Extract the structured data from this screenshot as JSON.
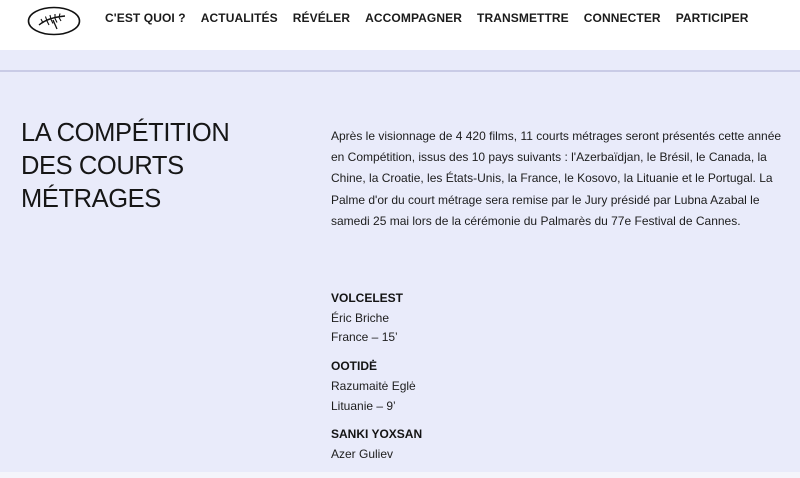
{
  "header": {
    "logo_icon": "palme-logo-icon",
    "nav": [
      {
        "label": "C'EST QUOI ?"
      },
      {
        "label": "ACTUALITÉS"
      },
      {
        "label": "RÉVÉLER"
      },
      {
        "label": "ACCOMPAGNER"
      },
      {
        "label": "TRANSMETTRE"
      },
      {
        "label": "CONNECTER"
      },
      {
        "label": "PARTICIPER"
      }
    ]
  },
  "main": {
    "title_lines": [
      "LA COMPÉTITION",
      "DES COURTS",
      "MÉTRAGES"
    ],
    "intro": "Après le visionnage de 4 420 films, 11 courts métrages seront présentés cette année en Compétition, issus des 10 pays suivants : l'Azerbaïdjan, le Brésil, le Canada, la Chine, la Croatie, les États-Unis, la France, le Kosovo, la Lituanie et le Portugal. La Palme d'or du court métrage sera remise par le Jury présidé par Lubna Azabal le samedi 25 mai lors de la cérémonie du Palmarès du 77e Festival de Cannes.",
    "films": [
      {
        "title": "VOLCELEST",
        "director": "Éric Briche",
        "info": "France – 15’"
      },
      {
        "title": "OOTIDĖ",
        "director": "Razumaitė Eglė",
        "info": "Lituanie – 9’"
      },
      {
        "title": "SANKI YOXSAN",
        "director": "Azer Guliev",
        "info": ""
      }
    ]
  },
  "colors": {
    "background": "#e9ebfa",
    "header_bg": "#ffffff",
    "text": "#111111"
  }
}
